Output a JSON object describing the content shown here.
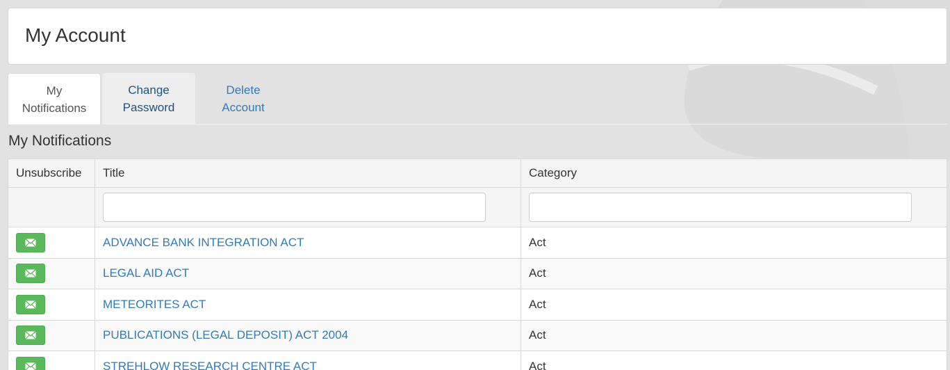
{
  "page": {
    "title": "My Account"
  },
  "tabs": [
    {
      "label_line1": "My",
      "label_line2": "Notifications",
      "state": "active"
    },
    {
      "label_line1": "Change",
      "label_line2": "Password",
      "state": "hover"
    },
    {
      "label_line1": "Delete",
      "label_line2": "Account",
      "state": "normal"
    }
  ],
  "section": {
    "title": "My Notifications"
  },
  "table": {
    "headers": {
      "unsubscribe": "Unsubscribe",
      "title": "Title",
      "category": "Category"
    },
    "filters": {
      "title_value": "",
      "category_value": ""
    },
    "rows": [
      {
        "title": "ADVANCE BANK INTEGRATION ACT",
        "category": "Act",
        "action_icon": "envelope-icon"
      },
      {
        "title": "LEGAL AID ACT",
        "category": "Act",
        "action_icon": "envelope-icon"
      },
      {
        "title": "METEORITES ACT",
        "category": "Act",
        "action_icon": "envelope-icon"
      },
      {
        "title": "PUBLICATIONS (LEGAL DEPOSIT) ACT 2004",
        "category": "Act",
        "action_icon": "envelope-icon"
      },
      {
        "title": "STREHLOW RESEARCH CENTRE ACT",
        "category": "Act",
        "action_icon": "envelope-icon"
      }
    ]
  },
  "colors": {
    "link": "#337ab7",
    "unsubscribe_button": "#5cb85c",
    "background": "#e2e2e2"
  }
}
